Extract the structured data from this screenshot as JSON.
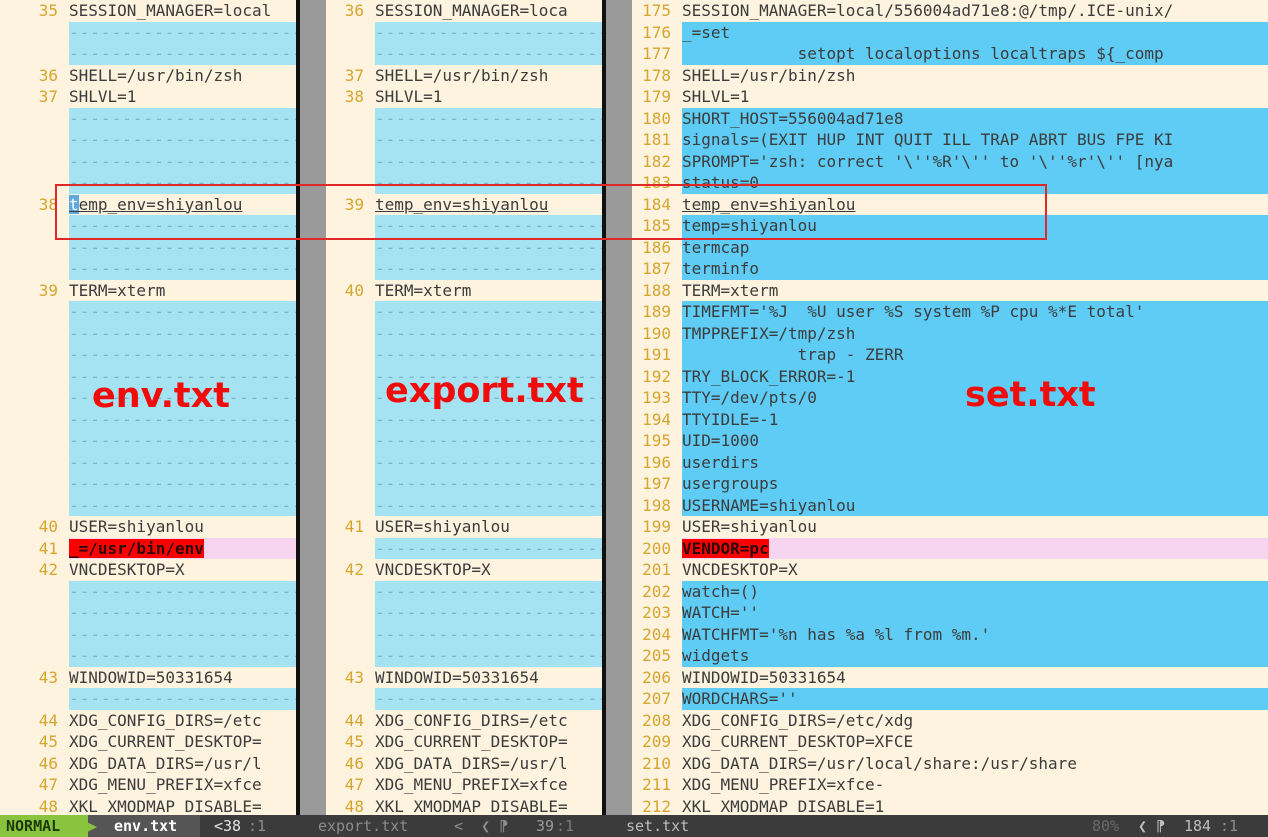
{
  "panes": [
    {
      "id": "env",
      "rows": [
        {
          "n": "35",
          "t": "SESSION_MANAGER=local",
          "bg": ""
        },
        {
          "filler": true
        },
        {
          "filler": true
        },
        {
          "n": "36",
          "t": "SHELL=/usr/bin/zsh",
          "bg": ""
        },
        {
          "n": "37",
          "t": "SHLVL=1",
          "bg": ""
        },
        {
          "filler": true
        },
        {
          "filler": true
        },
        {
          "filler": true
        },
        {
          "filler": true
        },
        {
          "n": "38",
          "t": "temp_env=shiyanlou",
          "bg": "",
          "underline": true,
          "cursor": true
        },
        {
          "filler": true
        },
        {
          "filler": true
        },
        {
          "filler": true
        },
        {
          "n": "39",
          "t": "TERM=xterm",
          "bg": ""
        },
        {
          "filler": true
        },
        {
          "filler": true
        },
        {
          "filler": true
        },
        {
          "filler": true
        },
        {
          "filler": true
        },
        {
          "filler": true
        },
        {
          "filler": true
        },
        {
          "filler": true
        },
        {
          "filler": true
        },
        {
          "filler": true
        },
        {
          "n": "40",
          "t": "USER=shiyanlou",
          "bg": ""
        },
        {
          "n": "41",
          "t": "_=/usr/bin/env",
          "bg": "pink",
          "red": true
        },
        {
          "n": "42",
          "t": "VNCDESKTOP=X",
          "bg": ""
        },
        {
          "filler": true
        },
        {
          "filler": true
        },
        {
          "filler": true
        },
        {
          "filler": true
        },
        {
          "n": "43",
          "t": "WINDOWID=50331654",
          "bg": ""
        },
        {
          "filler": true
        },
        {
          "n": "44",
          "t": "XDG_CONFIG_DIRS=/etc",
          "bg": ""
        },
        {
          "n": "45",
          "t": "XDG_CURRENT_DESKTOP=",
          "bg": ""
        },
        {
          "n": "46",
          "t": "XDG_DATA_DIRS=/usr/l",
          "bg": ""
        },
        {
          "n": "47",
          "t": "XDG_MENU_PREFIX=xfce",
          "bg": ""
        },
        {
          "n": "48",
          "t": "XKL_XMODMAP_DISABLE=",
          "bg": ""
        }
      ]
    },
    {
      "id": "export",
      "rows": [
        {
          "n": "36",
          "t": "SESSION_MANAGER=loca",
          "bg": ""
        },
        {
          "filler": true
        },
        {
          "filler": true
        },
        {
          "n": "37",
          "t": "SHELL=/usr/bin/zsh",
          "bg": ""
        },
        {
          "n": "38",
          "t": "SHLVL=1",
          "bg": ""
        },
        {
          "filler": true
        },
        {
          "filler": true
        },
        {
          "filler": true
        },
        {
          "filler": true
        },
        {
          "n": "39",
          "t": "temp_env=shiyanlou",
          "bg": "",
          "underline": true
        },
        {
          "filler": true
        },
        {
          "filler": true
        },
        {
          "filler": true
        },
        {
          "n": "40",
          "t": "TERM=xterm",
          "bg": ""
        },
        {
          "filler": true
        },
        {
          "filler": true
        },
        {
          "filler": true
        },
        {
          "filler": true
        },
        {
          "filler": true
        },
        {
          "filler": true
        },
        {
          "filler": true
        },
        {
          "filler": true
        },
        {
          "filler": true
        },
        {
          "filler": true
        },
        {
          "n": "41",
          "t": "USER=shiyanlou",
          "bg": ""
        },
        {
          "filler": true
        },
        {
          "n": "42",
          "t": "VNCDESKTOP=X",
          "bg": ""
        },
        {
          "filler": true
        },
        {
          "filler": true
        },
        {
          "filler": true
        },
        {
          "filler": true
        },
        {
          "n": "43",
          "t": "WINDOWID=50331654",
          "bg": ""
        },
        {
          "filler": true
        },
        {
          "n": "44",
          "t": "XDG_CONFIG_DIRS=/etc",
          "bg": ""
        },
        {
          "n": "45",
          "t": "XDG_CURRENT_DESKTOP=",
          "bg": ""
        },
        {
          "n": "46",
          "t": "XDG_DATA_DIRS=/usr/l",
          "bg": ""
        },
        {
          "n": "47",
          "t": "XDG_MENU_PREFIX=xfce",
          "bg": ""
        },
        {
          "n": "48",
          "t": "XKL_XMODMAP_DISABLE=",
          "bg": ""
        }
      ]
    },
    {
      "id": "set",
      "rows": [
        {
          "n": "175",
          "t": "SESSION_MANAGER=local/556004ad71e8:@/tmp/.ICE-unix/",
          "bg": ""
        },
        {
          "n": "176",
          "t": "_=set",
          "bg": "blue"
        },
        {
          "n": "177",
          "t": "            setopt localoptions localtraps ${_comp",
          "bg": "blue"
        },
        {
          "n": "178",
          "t": "SHELL=/usr/bin/zsh",
          "bg": ""
        },
        {
          "n": "179",
          "t": "SHLVL=1",
          "bg": ""
        },
        {
          "n": "180",
          "t": "SHORT_HOST=556004ad71e8",
          "bg": "blue"
        },
        {
          "n": "181",
          "t": "signals=(EXIT HUP INT QUIT ILL TRAP ABRT BUS FPE KI",
          "bg": "blue"
        },
        {
          "n": "182",
          "t": "SPROMPT='zsh: correct '\\''%R'\\'' to '\\''%r'\\'' [nya",
          "bg": "blue"
        },
        {
          "n": "183",
          "t": "status=0",
          "bg": "blue"
        },
        {
          "n": "184",
          "t": "temp_env=shiyanlou",
          "bg": "",
          "underline": true
        },
        {
          "n": "185",
          "t": "temp=shiyanlou",
          "bg": "blue"
        },
        {
          "n": "186",
          "t": "termcap",
          "bg": "blue"
        },
        {
          "n": "187",
          "t": "terminfo",
          "bg": "blue"
        },
        {
          "n": "188",
          "t": "TERM=xterm",
          "bg": ""
        },
        {
          "n": "189",
          "t": "TIMEFMT='%J  %U user %S system %P cpu %*E total'",
          "bg": "blue"
        },
        {
          "n": "190",
          "t": "TMPPREFIX=/tmp/zsh",
          "bg": "blue"
        },
        {
          "n": "191",
          "t": "            trap - ZERR",
          "bg": "blue"
        },
        {
          "n": "192",
          "t": "TRY_BLOCK_ERROR=-1",
          "bg": "blue"
        },
        {
          "n": "193",
          "t": "TTY=/dev/pts/0",
          "bg": "blue"
        },
        {
          "n": "194",
          "t": "TTYIDLE=-1",
          "bg": "blue"
        },
        {
          "n": "195",
          "t": "UID=1000",
          "bg": "blue"
        },
        {
          "n": "196",
          "t": "userdirs",
          "bg": "blue"
        },
        {
          "n": "197",
          "t": "usergroups",
          "bg": "blue"
        },
        {
          "n": "198",
          "t": "USERNAME=shiyanlou",
          "bg": "blue"
        },
        {
          "n": "199",
          "t": "USER=shiyanlou",
          "bg": ""
        },
        {
          "n": "200",
          "t": "VENDOR=pc",
          "bg": "pink",
          "red": true
        },
        {
          "n": "201",
          "t": "VNCDESKTOP=X",
          "bg": ""
        },
        {
          "n": "202",
          "t": "watch=()",
          "bg": "blue"
        },
        {
          "n": "203",
          "t": "WATCH=''",
          "bg": "blue"
        },
        {
          "n": "204",
          "t": "WATCHFMT='%n has %a %l from %m.'",
          "bg": "blue"
        },
        {
          "n": "205",
          "t": "widgets",
          "bg": "blue"
        },
        {
          "n": "206",
          "t": "WINDOWID=50331654",
          "bg": ""
        },
        {
          "n": "207",
          "t": "WORDCHARS=''",
          "bg": "blue"
        },
        {
          "n": "208",
          "t": "XDG_CONFIG_DIRS=/etc/xdg",
          "bg": ""
        },
        {
          "n": "209",
          "t": "XDG_CURRENT_DESKTOP=XFCE",
          "bg": ""
        },
        {
          "n": "210",
          "t": "XDG_DATA_DIRS=/usr/local/share:/usr/share",
          "bg": ""
        },
        {
          "n": "211",
          "t": "XDG_MENU_PREFIX=xfce-",
          "bg": ""
        },
        {
          "n": "212",
          "t": "XKL_XMODMAP_DISABLE=1",
          "bg": ""
        }
      ]
    }
  ],
  "filler_text": "----------------------------------------------------------------------------",
  "labels": {
    "env": "env.txt",
    "export": "export.txt",
    "set": "set.txt"
  },
  "status": {
    "mode": "NORMAL",
    "sep1": "▶",
    "env_file": "env.txt",
    "env_pos": "<38",
    "env_col": ":1",
    "export_file": "export.txt",
    "export_arrows": "<  ❮ ⁋",
    "export_pos": "39",
    "export_col": ":1",
    "set_file": "set.txt",
    "set_pct": "80%",
    "set_arrows": "❮ ⁋",
    "set_pos": "184",
    "set_col": ":1"
  },
  "colors": {
    "diff_added": "#5fccf5",
    "diff_filler": "#a6e3f2",
    "diff_changed": "#f7d5f0",
    "diff_text": "#fc0000",
    "annotation": "#f10c0c"
  }
}
